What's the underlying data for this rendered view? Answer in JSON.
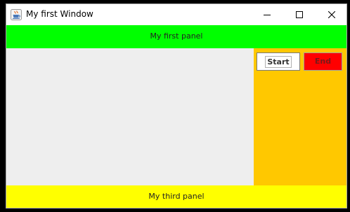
{
  "window": {
    "title": "My first Window",
    "icon": "java-cup-icon",
    "controls": {
      "minimize_icon": "minimize-icon",
      "maximize_icon": "maximize-icon",
      "close_icon": "close-icon"
    }
  },
  "panels": {
    "top": {
      "label": "My first panel",
      "color": "#00ff00"
    },
    "center": {
      "color": "#eeeeee"
    },
    "right": {
      "color": "#ffc800"
    },
    "bottom": {
      "label": "My third panel",
      "color": "#ffff00"
    }
  },
  "buttons": {
    "start": {
      "label": "Start",
      "background": "#ffffff",
      "text_color": "#333333"
    },
    "end": {
      "label": "End",
      "background": "#ff0000",
      "text_color": "#7a1a1a"
    }
  }
}
